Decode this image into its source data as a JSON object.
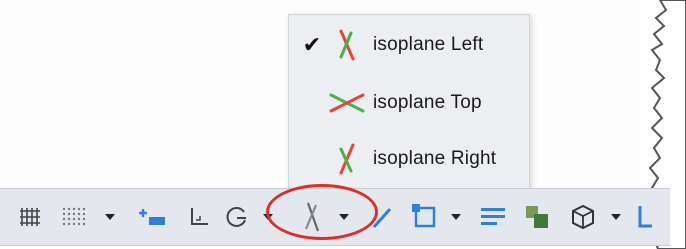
{
  "isoplane_menu": {
    "items": [
      {
        "label": "isoplane Left",
        "checked": true,
        "icon": "isoplane-left-icon"
      },
      {
        "label": "isoplane Top",
        "checked": false,
        "icon": "isoplane-top-icon"
      },
      {
        "label": "isoplane Right",
        "checked": false,
        "icon": "isoplane-right-icon"
      }
    ],
    "check_glyph": "✔"
  },
  "statusbar": {
    "buttons": [
      "grid-display-icon",
      "snap-mode-icon",
      "snap-dropdown-icon",
      "dynamic-input-icon",
      "ortho-mode-icon",
      "polar-tracking-icon",
      "polar-dropdown-icon",
      "isometric-drafting-icon",
      "isometric-dropdown-icon",
      "object-snap-tracking-icon",
      "object-snap-icon",
      "osnap-dropdown-icon",
      "lineweight-icon",
      "transparency-icon",
      "3d-object-snap-icon",
      "3d-osnap-dropdown-icon",
      "ucs-icon"
    ]
  },
  "colors": {
    "isoplane_red": "#e0483a",
    "isoplane_green": "#4caf50",
    "toolbar_blue": "#2f7fd6",
    "highlight_ring": "#d8302a",
    "menu_bg": "#eceef2",
    "statusbar_bg": "#e4e8ee"
  }
}
